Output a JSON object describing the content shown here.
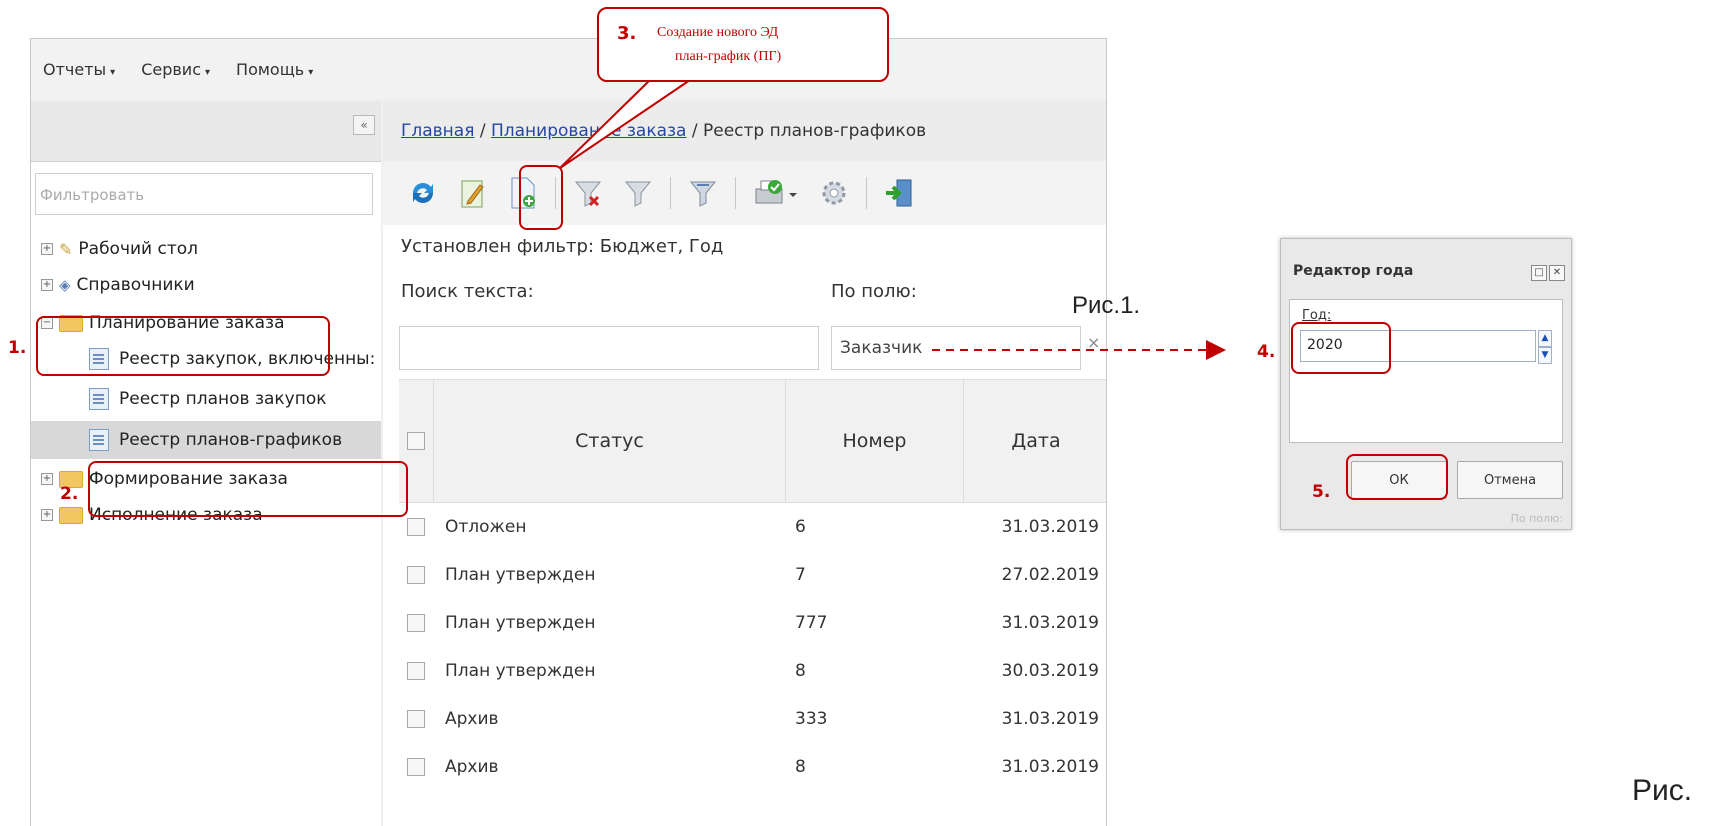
{
  "menu": [
    {
      "label": "Отчеты"
    },
    {
      "label": "Сервис"
    },
    {
      "label": "Помощь"
    }
  ],
  "left_panel": {
    "collapse_icon": "double-chevron-left-icon",
    "filter_placeholder": "Фильтровать",
    "tree": [
      {
        "label": "Рабочий стол",
        "icon": "desktop-icon"
      },
      {
        "label": "Справочники",
        "icon": "books-icon"
      },
      {
        "label": "Планирование заказа",
        "icon": "folder-icon"
      },
      {
        "label": "Реестр закупок, включенны:",
        "icon": "document-icon"
      },
      {
        "label": "Реестр планов закупок",
        "icon": "document-icon"
      },
      {
        "label": "Реестр планов-графиков",
        "icon": "document-icon"
      },
      {
        "label": "Формирование заказа",
        "icon": "folder-icon"
      },
      {
        "label": "Исполнение заказа",
        "icon": "folder-icon"
      }
    ]
  },
  "breadcrumb": {
    "home": "Главная",
    "sep": " / ",
    "planning": "Планирование заказа",
    "current": "Реестр планов-графиков"
  },
  "toolbar": {
    "icons": [
      "refresh-icon",
      "edit-icon",
      "new-document-icon",
      "clear-filter-icon",
      "filter-icon",
      "filter-funnel-icon",
      "print-icon",
      "settings-icon",
      "exit-icon"
    ]
  },
  "filter_info": "Установлен фильтр: Бюджет, Год",
  "search": {
    "label": "Поиск текста:",
    "value": "",
    "field_label": "По полю:",
    "field_value": "Заказчик",
    "clear": "×"
  },
  "grid": {
    "columns": [
      "Статус",
      "Номер",
      "Дата"
    ],
    "rows": [
      {
        "status": "Отложен",
        "number": "6",
        "date": "31.03.2019"
      },
      {
        "status": "План утвержден",
        "number": "7",
        "date": "27.02.2019"
      },
      {
        "status": "План утвержден",
        "number": "777",
        "date": "31.03.2019"
      },
      {
        "status": "План утвержден",
        "number": "8",
        "date": "30.03.2019"
      },
      {
        "status": "Архив",
        "number": "333",
        "date": "31.03.2019"
      },
      {
        "status": "Архив",
        "number": "8",
        "date": "31.03.2019"
      }
    ]
  },
  "dialog": {
    "title": "Редактор года",
    "field_label": "Год:",
    "year_value": "2020",
    "ok": "ОК",
    "cancel": "Отмена",
    "bottom_text": "По полю:"
  },
  "annotations": {
    "n1": "1.",
    "n2": "2.",
    "n3": "3.",
    "n4": "4.",
    "n5": "5.",
    "callout_line1": "Создание нового ЭД",
    "callout_line2": "план-график (ПГ)",
    "caption1": "Рис.1.",
    "caption2": "Рис.",
    "color": "#c00000"
  }
}
